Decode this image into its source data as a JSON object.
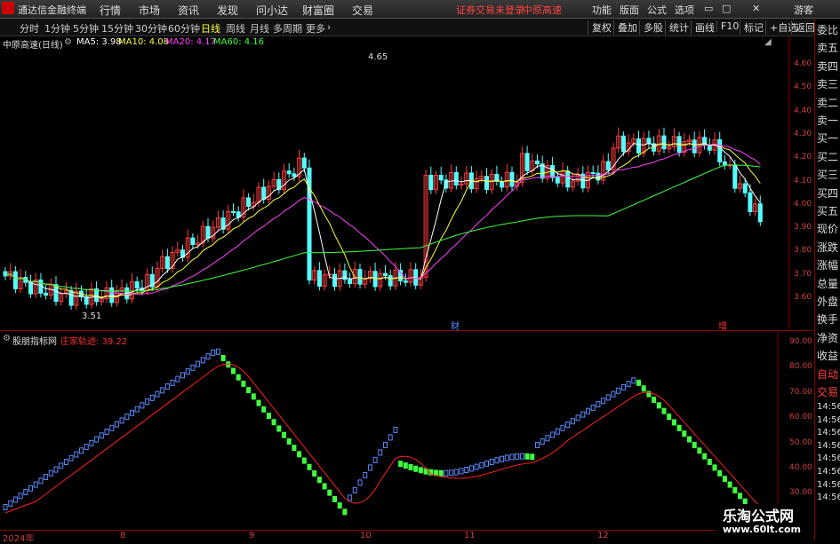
{
  "titlebar": {
    "app": "通达信金融终端",
    "menus": [
      "行情",
      "市场",
      "资讯",
      "发现",
      "问小达",
      "财富圈",
      "交易"
    ],
    "notice": "证券交易未登录",
    "stock": "中原高速",
    "right_menus": [
      "功能",
      "版面",
      "公式",
      "选项"
    ],
    "guest": "游客"
  },
  "toolbar": {
    "periods": [
      "分时",
      "1分钟",
      "5分钟",
      "15分钟",
      "30分钟",
      "60分钟",
      "日线",
      "周线",
      "月线",
      "多周期",
      "更多"
    ],
    "active": "日线",
    "right": [
      "复权",
      "叠加",
      "多股",
      "统计",
      "画线",
      "F10",
      "标记",
      "+自选",
      "返回"
    ]
  },
  "main": {
    "title": "中原高速(日线)",
    "ma": [
      {
        "label": "MA5: 3.98",
        "color": "#ffffff"
      },
      {
        "label": "MA10: 4.08",
        "color": "#ffff40"
      },
      {
        "label": "MA20: 4.17",
        "color": "#ff40ff"
      },
      {
        "label": "MA60: 4.16",
        "color": "#40ff40"
      }
    ],
    "yticks": [
      "4.60",
      "4.50",
      "4.40",
      "4.30",
      "4.20",
      "4.10",
      "4.00",
      "3.90",
      "3.80",
      "3.70",
      "3.60"
    ],
    "high_label": "4.65",
    "low_label": "3.51",
    "marker1": "财",
    "marker2": "增"
  },
  "sub": {
    "title": "股朋指标网",
    "line": "庄家轨迹: 39.22",
    "yticks": [
      "90.00",
      "80.00",
      "70.00",
      "60.00",
      "50.00",
      "40.00",
      "30.00"
    ]
  },
  "xaxis": [
    "2024年",
    "8",
    "9",
    "10",
    "11",
    "12"
  ],
  "right_panel": [
    "委比",
    "卖五",
    "卖四",
    "卖三",
    "卖二",
    "卖一",
    "买一",
    "买二",
    "买三",
    "买四",
    "买五",
    "现价",
    "涨跌",
    "涨幅",
    "总量",
    "外盘",
    "换手",
    "净资",
    "收益",
    "自动",
    "交易",
    "14:56",
    "14:56",
    "14:56",
    "14:56",
    "14:56",
    "14:56",
    "14:56",
    "14:56"
  ],
  "watermark": {
    "line1": "乐淘公式网",
    "line2": "www.60lt.com"
  },
  "colors": {
    "up": "#ff3c3c",
    "down": "#54ffff",
    "ma5": "#ffffff",
    "ma10": "#ffff40",
    "ma20": "#ff40ff",
    "ma60": "#40ff40",
    "ind_up": "#5a8cff",
    "ind_down": "#40ff40",
    "ind_line": "#ff2020"
  }
}
